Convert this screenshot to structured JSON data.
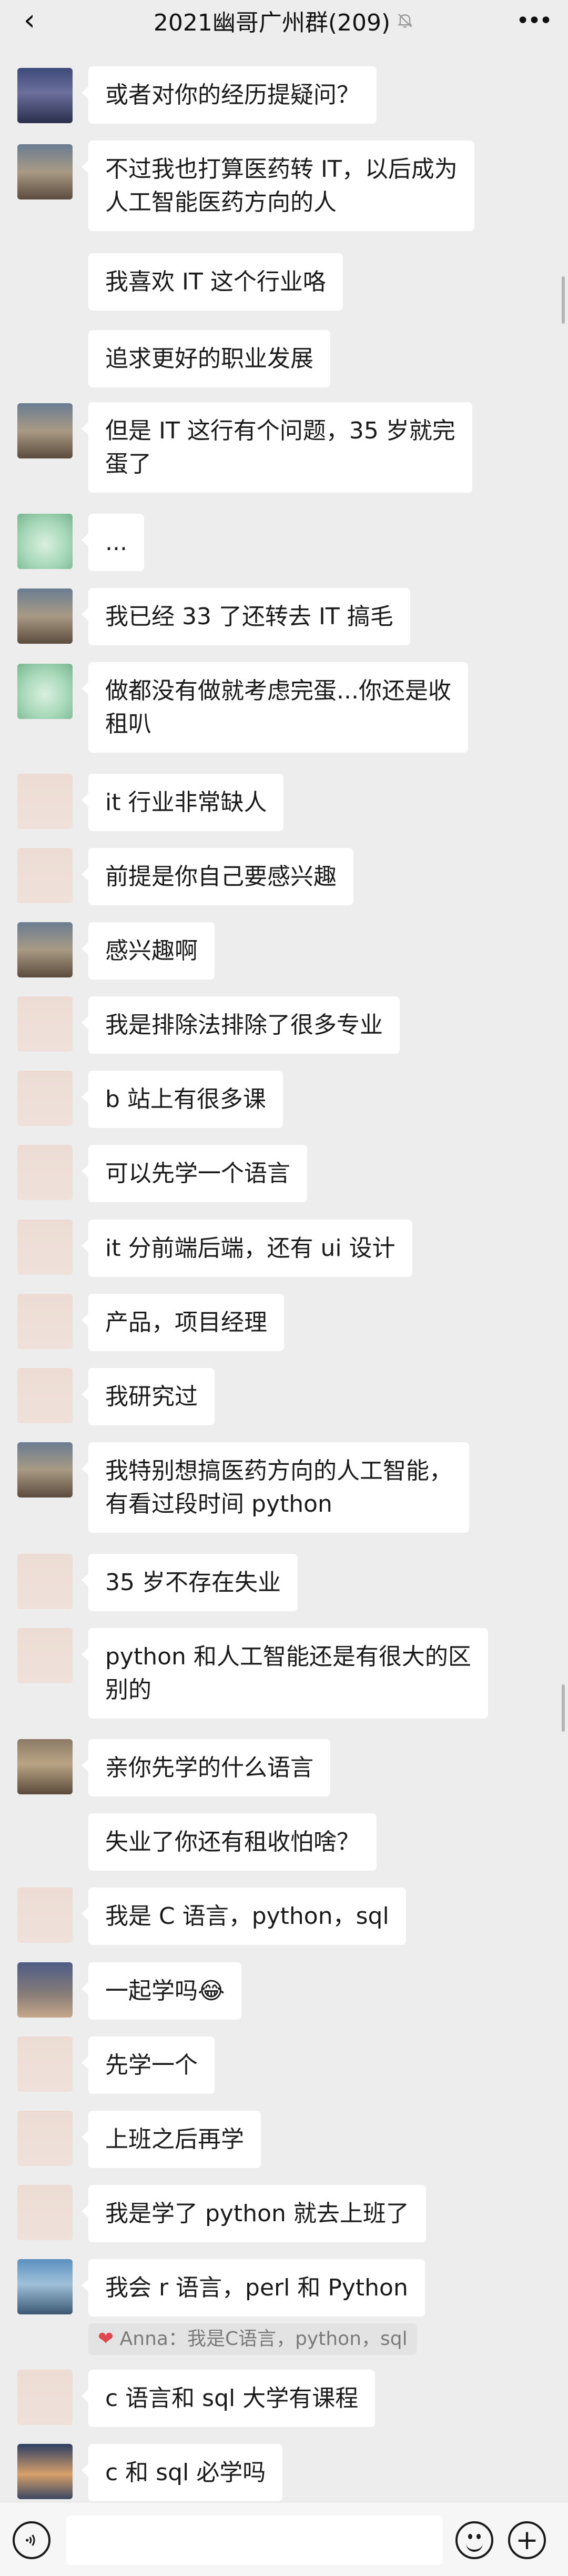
{
  "header": {
    "title": "2021幽哥广州群(209)",
    "back_icon": "chevron-left-icon",
    "mute_icon": "bell-muted-icon",
    "more_icon": "more-dots-icon"
  },
  "messages": [
    {
      "avatar": "a",
      "text": "或者对你的经历提疑问？"
    },
    {
      "avatar": "b",
      "lines": [
        "不过我也打算医药转 IT，以后成为",
        "人工智能医药方向的人"
      ]
    },
    {
      "avatar": null,
      "text": "我喜欢 IT 这个行业咯"
    },
    {
      "avatar": null,
      "text": "追求更好的职业发展"
    },
    {
      "avatar": "b",
      "lines": [
        "但是 IT 这行有个问题，35 岁就完",
        "蛋了"
      ]
    },
    {
      "avatar": "c",
      "text": "..."
    },
    {
      "avatar": "b",
      "text": "我已经 33 了还转去 IT 搞毛"
    },
    {
      "avatar": "c",
      "lines": [
        "做都没有做就考虑完蛋...你还是收",
        "租叭"
      ]
    },
    {
      "avatar": "d",
      "text": "it 行业非常缺人"
    },
    {
      "avatar": "d",
      "text": "前提是你自己要感兴趣"
    },
    {
      "avatar": "b",
      "text": "感兴趣啊"
    },
    {
      "avatar": "d",
      "text": "我是排除法排除了很多专业"
    },
    {
      "avatar": "d",
      "text": "b 站上有很多课"
    },
    {
      "avatar": "d",
      "text": "可以先学一个语言"
    },
    {
      "avatar": "d",
      "text": "it 分前端后端，还有 ui 设计"
    },
    {
      "avatar": "d",
      "text": "产品，项目经理"
    },
    {
      "avatar": "d",
      "text": "我研究过"
    },
    {
      "avatar": "b",
      "lines": [
        "我特别想搞医药方向的人工智能，",
        "有看过段时间 python"
      ]
    },
    {
      "avatar": "d",
      "text": "35 岁不存在失业"
    },
    {
      "avatar": "d",
      "lines": [
        "python 和人工智能还是有很大的区",
        "别的"
      ]
    },
    {
      "avatar": "e",
      "text": "亲你先学的什么语言"
    },
    {
      "avatar": null,
      "text": "失业了你还有租收怕啥？"
    },
    {
      "avatar": "d",
      "text": "我是 C 语言，python，sql"
    },
    {
      "avatar": "f",
      "text": "一起学吗😂"
    },
    {
      "avatar": "d",
      "text": "先学一个"
    },
    {
      "avatar": "d",
      "text": "上班之后再学"
    },
    {
      "avatar": "d",
      "text": "我是学了 python 就去上班了"
    },
    {
      "avatar": "g",
      "text": "我会 r 语言，perl 和 Python",
      "quote": "Anna：我是C语言，python，sql"
    },
    {
      "avatar": "d",
      "text": "c 语言和 sql 大学有课程"
    },
    {
      "avatar": "h",
      "text": "c 和 sql 必学吗"
    }
  ],
  "footer": {
    "voice_icon": "voice-icon",
    "input_value": "",
    "emoji_icon": "emoji-icon",
    "plus_icon": "plus-icon"
  },
  "colors": {
    "background": "#ededed",
    "bubble": "#ffffff",
    "text": "#1a1a1a",
    "quote_bg": "#e3e3e3",
    "quote_text": "#7a7a7a"
  }
}
